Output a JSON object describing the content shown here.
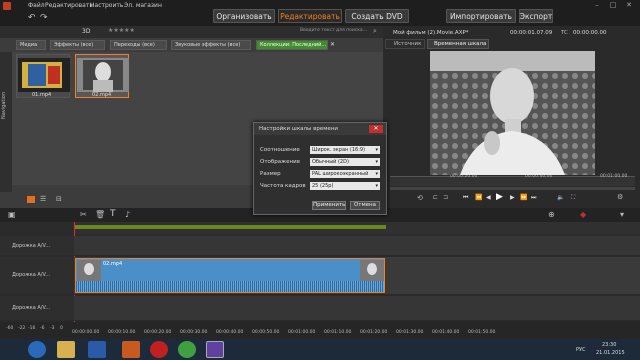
{
  "menu": [
    "Файл",
    "Редактировать",
    "Настроить",
    "Эл. магазин"
  ],
  "modes": {
    "organize": "Организовать",
    "edit": "Редактировать",
    "create_dvd": "Создать DVD",
    "import": "Импортировать",
    "export": "Экспорт"
  },
  "library": {
    "view_3d": "3D",
    "rating": "★★★★★",
    "search_placeholder": "Введите текст для поиска...",
    "tabs": [
      "Медиа",
      "Эффекты (все)",
      "Переходы (все)",
      "Звуковые эффекты (все)",
      "Коллекции: Последний..."
    ],
    "nav_label": "Navigation",
    "items": [
      {
        "name": "01.mp4"
      },
      {
        "name": "02.mp4"
      }
    ]
  },
  "preview": {
    "title": "Мой фильм (2).Movie.AXP*",
    "timecode_left": "00:00:01.07.09",
    "tc_label": "TC",
    "timecode_right": "00:00:00.00",
    "tab_source": "Источник",
    "tab_timeline": "Временная шкала",
    "ruler": [
      "00:00:20.00",
      "00:00:40.00",
      "00:01:00.00"
    ]
  },
  "dialog": {
    "title": "Настройки шкалы времени",
    "rows": [
      {
        "label": "Соотношение",
        "value": "Широк. экран (16:9)"
      },
      {
        "label": "Отображение",
        "value": "Обычный (2D)"
      },
      {
        "label": "Размер",
        "value": "PAL широкоэкранный"
      },
      {
        "label": "Частота кадров",
        "value": "25 (25p)"
      }
    ],
    "apply": "Применить",
    "cancel": "Отмена"
  },
  "tracks": [
    {
      "label": "Дорожка A/V..."
    },
    {
      "label": "Дорожка A/V..."
    },
    {
      "label": "Дорожка A/V..."
    }
  ],
  "clip_label": "02.mp4",
  "bottom_ruler": [
    "-60",
    "-22",
    "-16",
    "-6",
    "-3",
    "0",
    "00:00:00.00",
    "00:00:10.00",
    "00:00:20.00",
    "00:00:30.00",
    "00:00:40.00",
    "00:00:50.00",
    "00:01:00.00",
    "00:01:10.00",
    "00:01:20.00",
    "00:01:30.00",
    "00:01:40.00",
    "00:01:50.00"
  ],
  "taskbar": {
    "lang": "РУС",
    "time": "23:30",
    "date": "21.01.2015"
  }
}
